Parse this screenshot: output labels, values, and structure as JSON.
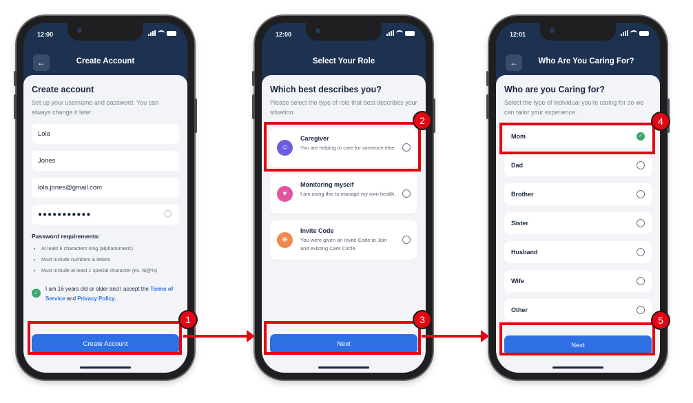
{
  "screens": [
    {
      "time": "12:00",
      "header_title": "Create Account",
      "title": "Create account",
      "subtitle": "Set up your username and password. You can always change it later.",
      "fields": [
        {
          "value": "Lola"
        },
        {
          "value": "Jones"
        },
        {
          "value": "lola.jones@gmail.com"
        },
        {
          "value": "●●●●●●●●●●●"
        }
      ],
      "req_title": "Password requirements:",
      "requirements": [
        "At least 6 characters long (alphanumeric)",
        "Must include numbers & letters",
        "Must include at least 1 special character (ex. !$@%)"
      ],
      "terms_text": "I am 16 years old or older and I accept the",
      "terms_link": "Terms of Service",
      "terms_and": "and",
      "privacy_link": "Privacy Policy",
      "terms_end": ".",
      "button": "Create Account"
    },
    {
      "time": "12:00",
      "header_title": "Select Your Role",
      "title": "Which best describes you?",
      "subtitle": "Please select the type of role that best describes your situation.",
      "roles": [
        {
          "title": "Caregiver",
          "desc": "You are helping to care for someone else.",
          "icon": "caregiver-icon",
          "color": "#6b5fe0"
        },
        {
          "title": "Monitoring myself",
          "desc": "I am using this to manage my own health.",
          "icon": "heart-icon",
          "color": "#e0559f"
        },
        {
          "title": "Invite Code",
          "desc": "You were given an Invite Code to Join and existing Care Circle.",
          "icon": "network-icon",
          "color": "#f08a4b"
        }
      ],
      "button": "Next"
    },
    {
      "time": "12:01",
      "header_title": "Who Are You Caring For?",
      "title": "Who are you Caring for?",
      "subtitle": "Select the type of individual you're caring for so we can tailor your experience.",
      "options": [
        {
          "label": "Mom",
          "selected": true
        },
        {
          "label": "Dad"
        },
        {
          "label": "Brother"
        },
        {
          "label": "Sister"
        },
        {
          "label": "Husband"
        },
        {
          "label": "Wife"
        },
        {
          "label": "Other"
        }
      ],
      "button": "Next"
    }
  ],
  "steps": [
    "1",
    "2",
    "3",
    "4",
    "5"
  ],
  "colors": {
    "navy": "#1d3250",
    "primary": "#2f6fe4",
    "success": "#3aa66b",
    "highlight": "#e30613"
  }
}
